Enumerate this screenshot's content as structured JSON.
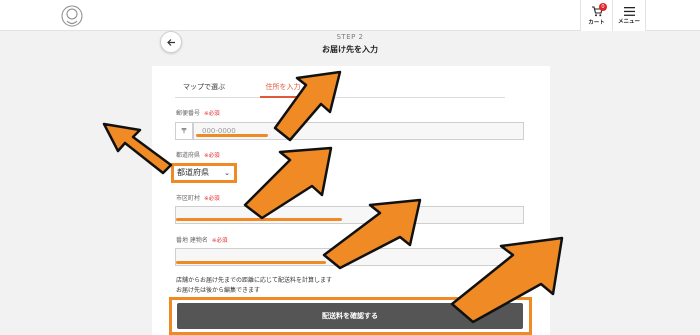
{
  "header": {
    "cart_label": "カート",
    "cart_count": "0",
    "menu_label": "メニュー"
  },
  "step": {
    "label": "STEP 2",
    "title": "お届け先を入力"
  },
  "tabs": [
    {
      "label": "マップで選ぶ"
    },
    {
      "label": "住所を入力"
    }
  ],
  "form": {
    "zip_label": "郵便番号",
    "zip_prefix": "〒",
    "zip_placeholder": "000-0000",
    "pref_label": "都道府県",
    "pref_value": "都道府県",
    "city_label": "市区町村",
    "street_label": "番地 建物名",
    "required": "※必須"
  },
  "notes": {
    "line1": "店舗からお届け先までの距離に応じて配送料を計算します",
    "line2": "お届け先は後から編集できます"
  },
  "submit_label": "配送料を確認する",
  "colors": {
    "accent": "#e05a3a",
    "highlight": "#f08a24",
    "button": "#555555"
  }
}
